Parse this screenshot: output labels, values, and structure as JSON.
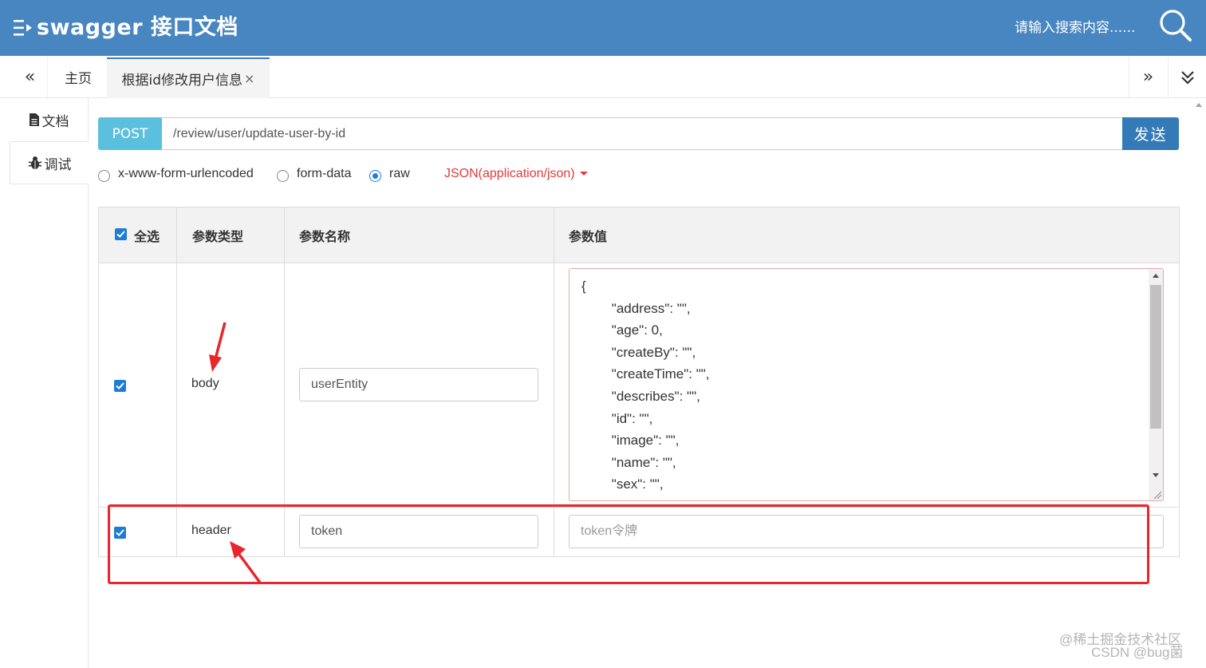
{
  "header": {
    "brand": "swagger 接口文档",
    "search_text": "请输入搜索内容......",
    "bg_color": "#4786c1"
  },
  "tabs": {
    "prev_icon": "«",
    "next_icon": "»",
    "home_label": "主页",
    "active_label": "根据id修改用户信息",
    "close_icon": "×"
  },
  "sidebar": {
    "doc_label": "文档",
    "debug_label": "调试"
  },
  "request": {
    "method": "POST",
    "url": "/review/user/update-user-by-id",
    "send_label": "发送",
    "method_color": "#5bc0de",
    "send_color": "#337ab7"
  },
  "body_types": {
    "options": [
      "x-www-form-urlencoded",
      "form-data",
      "raw"
    ],
    "selected": "raw",
    "content_type": "JSON(application/json)"
  },
  "table": {
    "headers": {
      "select_all": "全选",
      "param_type": "参数类型",
      "param_name": "参数名称",
      "param_value": "参数值"
    },
    "rows": [
      {
        "checked": true,
        "type": "body",
        "name": "userEntity",
        "value": "{\n        \"address\": \"\",\n        \"age\": 0,\n        \"createBy\": \"\",\n        \"createTime\": \"\",\n        \"describes\": \"\",\n        \"id\": \"\",\n        \"image\": \"\",\n        \"name\": \"\",\n        \"sex\": \"\","
      },
      {
        "checked": true,
        "type": "header",
        "name": "token",
        "value_placeholder": "token令牌"
      }
    ]
  },
  "annotation": {
    "highlight_color": "#e8262b"
  },
  "watermark": {
    "line1": "@稀土掘金技术社区",
    "line2": "CSDN @bug菌"
  }
}
